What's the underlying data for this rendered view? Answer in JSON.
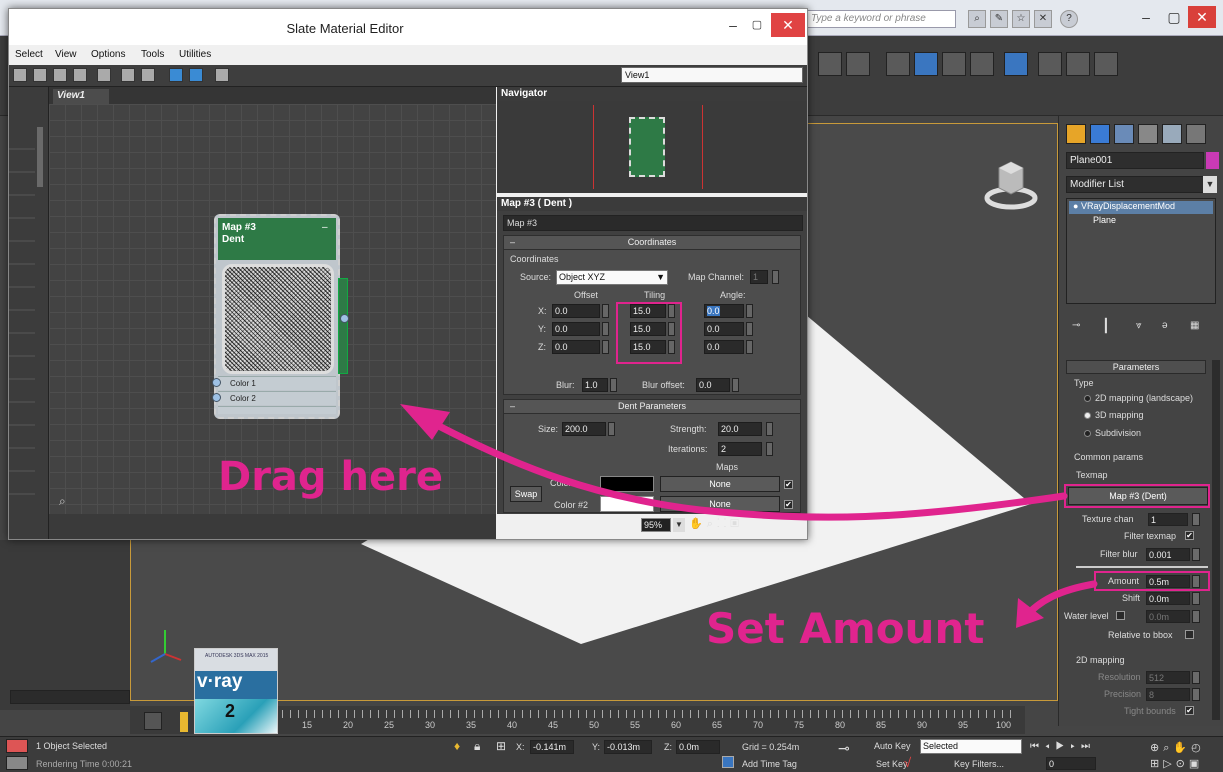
{
  "max": {
    "search_placeholder": "Type a keyword or phrase",
    "min_btn": "–",
    "restore_btn": "▢",
    "close_btn": "✕",
    "help_btn": "?"
  },
  "command_panel": {
    "object_name": "Plane001",
    "modifier_list": "Modifier List",
    "stack": [
      "VRayDisplacementMod",
      "Plane"
    ],
    "parameters_title": "Parameters",
    "type_label": "Type",
    "type_options": [
      {
        "label": "2D mapping (landscape)",
        "selected": false
      },
      {
        "label": "3D mapping",
        "selected": true
      },
      {
        "label": "Subdivision",
        "selected": false
      }
    ],
    "common_params_label": "Common params",
    "texmap_label": "Texmap",
    "texmap_button": "Map #3  (Dent)",
    "texture_chan_label": "Texture chan",
    "texture_chan_value": "1",
    "filter_texmap_label": "Filter texmap",
    "filter_blur_label": "Filter blur",
    "filter_blur_value": "0.001",
    "amount_label": "Amount",
    "amount_value": "0.5m",
    "shift_label": "Shift",
    "shift_value": "0.0m",
    "water_level_label": "Water level",
    "water_level_value": "0.0m",
    "relative_bbox_label": "Relative to bbox",
    "mapping2d_label": "2D mapping",
    "resolution_label": "Resolution",
    "resolution_value": "512",
    "precision_label": "Precision",
    "precision_value": "8",
    "tight_bounds_label": "Tight bounds"
  },
  "timeline": {
    "ticks": [
      "15",
      "20",
      "25",
      "30",
      "35",
      "40",
      "45",
      "50",
      "55",
      "60",
      "65",
      "70",
      "75",
      "80",
      "85",
      "90",
      "95",
      "100"
    ]
  },
  "status": {
    "selection": "1 Object Selected",
    "rendering": "Rendering Time  0:00:21",
    "x_label": "X:",
    "x_value": "-0.141m",
    "y_label": "Y:",
    "y_value": "-0.013m",
    "z_label": "Z:",
    "z_value": "0.0m",
    "grid": "Grid = 0.254m",
    "auto_key": "Auto Key",
    "selected_dropdown": "Selected",
    "set_key": "Set Key",
    "key_filters": "Key Filters...",
    "add_time_tag": "Add Time Tag",
    "frame_value": "0"
  },
  "vray_badge": {
    "brand": "AUTODESK 3DS MAX 2015",
    "logo": "v·ray",
    "version": "2"
  },
  "sme": {
    "title": "Slate Material Editor",
    "menus": [
      "Select",
      "View",
      "Options",
      "Tools",
      "Utilities"
    ],
    "view_dropdown": "View1",
    "view_tab": "View1",
    "navigator_title": "Navigator",
    "params_title": "Map #3  ( Dent )",
    "map_name": "Map #3",
    "node": {
      "title_line1": "Map #3",
      "title_line2": "Dent",
      "slots": [
        "Color 1",
        "Color 2"
      ]
    },
    "coords": {
      "rollout_title": "Coordinates",
      "group_label": "Coordinates",
      "source_label": "Source:",
      "source_value": "Object XYZ",
      "map_channel_label": "Map Channel:",
      "map_channel_value": "1",
      "offset_label": "Offset",
      "tiling_label": "Tiling",
      "angle_label": "Angle:",
      "axis_labels": [
        "X:",
        "Y:",
        "Z:"
      ],
      "offset": [
        "0.0",
        "0.0",
        "0.0"
      ],
      "tiling": [
        "15.0",
        "15.0",
        "15.0"
      ],
      "angle": [
        "0.0",
        "0.0",
        "0.0"
      ],
      "blur_label": "Blur:",
      "blur_value": "1.0",
      "blur_offset_label": "Blur offset:",
      "blur_offset_value": "0.0"
    },
    "dent": {
      "rollout_title": "Dent Parameters",
      "size_label": "Size:",
      "size_value": "200.0",
      "strength_label": "Strength:",
      "strength_value": "20.0",
      "iterations_label": "Iterations:",
      "iterations_value": "2",
      "maps_label": "Maps",
      "swap_label": "Swap",
      "color1_label": "Color",
      "color2_label": "Color #2",
      "none1": "None",
      "none2": "None"
    },
    "zoom": "95%",
    "min_btn": "–",
    "max_btn": "▢",
    "close_btn": "✕"
  },
  "annotations": {
    "drag_here": "Drag here",
    "set_amount": "Set Amount",
    "color": "#e0248e"
  }
}
